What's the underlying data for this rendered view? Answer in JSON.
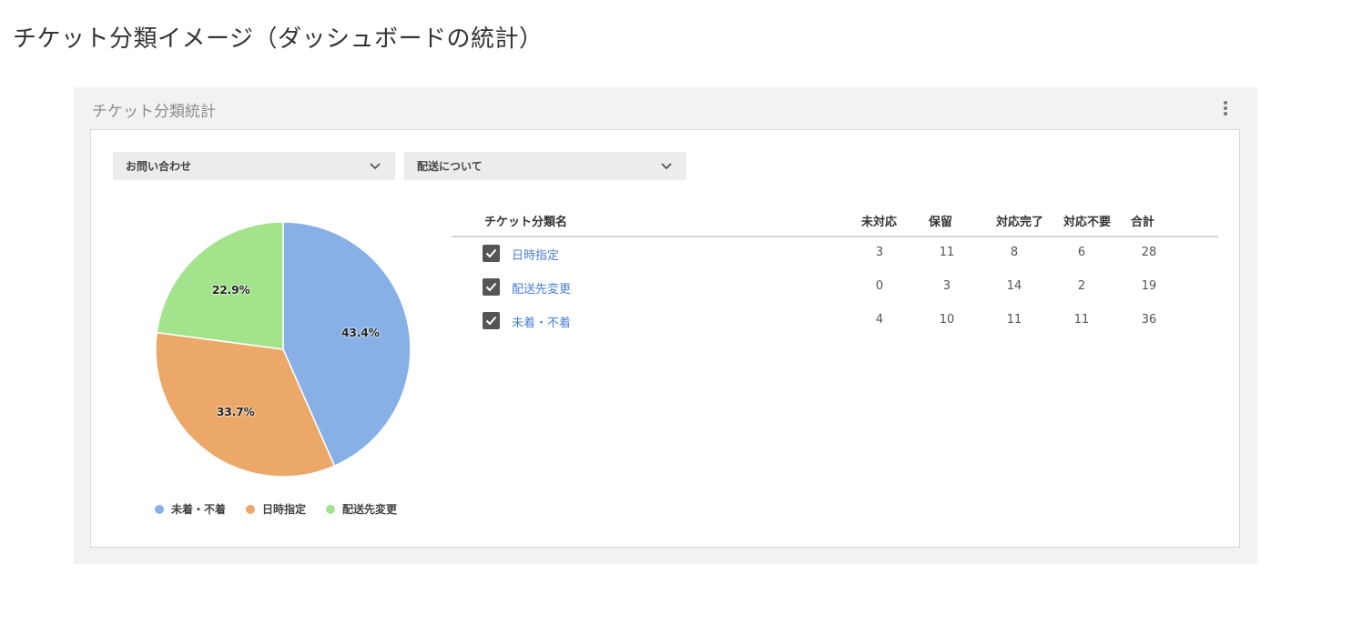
{
  "page_heading": "チケット分類イメージ（ダッシュボードの統計）",
  "widget": {
    "title": "チケット分類統計",
    "more_icon": "more-vertical-icon"
  },
  "filters": {
    "primary": "お問い合わせ",
    "secondary": "配送について"
  },
  "table": {
    "headers": [
      "チケット分類名",
      "未対応",
      "保留",
      "対応完了",
      "対応不要",
      "合計"
    ],
    "rows": [
      {
        "name": "日時指定",
        "checked": true,
        "values": [
          "3",
          "11",
          "8",
          "6",
          "28"
        ]
      },
      {
        "name": "配送先変更",
        "checked": true,
        "values": [
          "0",
          "3",
          "14",
          "2",
          "19"
        ]
      },
      {
        "name": "未着・不着",
        "checked": true,
        "values": [
          "4",
          "10",
          "11",
          "11",
          "36"
        ]
      }
    ]
  },
  "chart_data": {
    "type": "pie",
    "slices": [
      {
        "label": "未着・不着",
        "value": 43.4,
        "display": "43.4%",
        "color": "#87b1e6"
      },
      {
        "label": "日時指定",
        "value": 33.7,
        "display": "33.7%",
        "color": "#eba868"
      },
      {
        "label": "配送先変更",
        "value": 22.9,
        "display": "22.9%",
        "color": "#a3e38c"
      }
    ],
    "legend_position": "bottom"
  }
}
